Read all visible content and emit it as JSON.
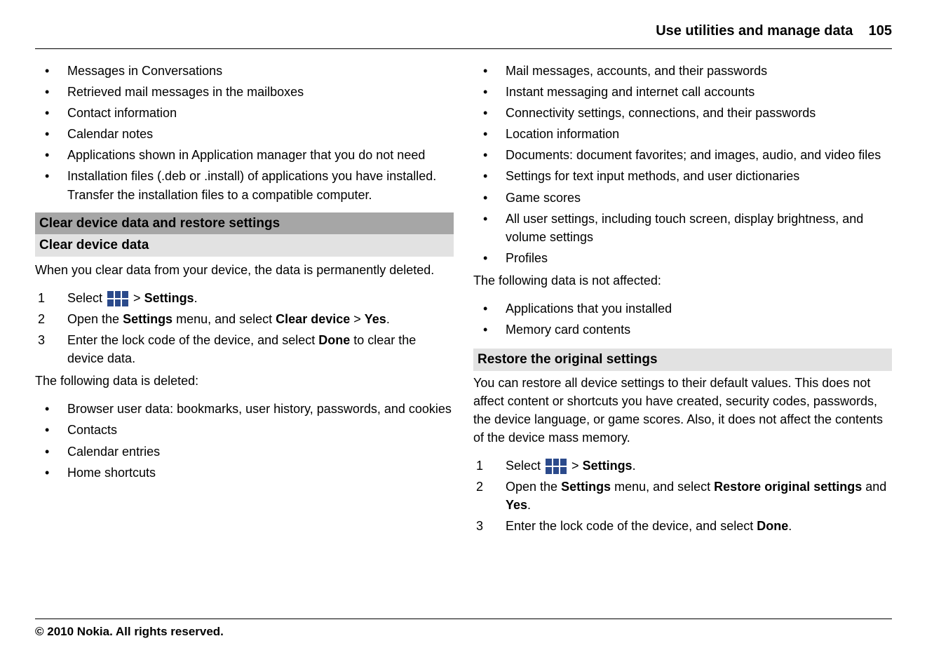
{
  "header": {
    "section_title": "Use utilities and manage data",
    "page_number": "105"
  },
  "left": {
    "top_bullets": [
      "Messages in Conversations",
      "Retrieved mail messages in the mailboxes",
      "Contact information",
      "Calendar notes",
      "Applications shown in Application manager that you do not need",
      "Installation files (.deb or .install) of applications you have installed. Transfer the installation files to a compatible computer."
    ],
    "heading_dark": "Clear device data and restore settings",
    "heading_light": "Clear device data",
    "intro": "When you clear data from your device, the data is permanently deleted.",
    "step1_prefix": "Select ",
    "step1_sep": " > ",
    "step1_bold": "Settings",
    "step1_period": ".",
    "step2_prefix": "Open the ",
    "step2_b1": "Settings",
    "step2_mid": " menu, and select ",
    "step2_b2": "Clear device",
    "step2_sep": " > ",
    "step2_b3": "Yes",
    "step2_period": ".",
    "step3_prefix": "Enter the lock code of the device, and select ",
    "step3_b1": "Done",
    "step3_suffix": " to clear the device data.",
    "deleted_intro": "The following data is deleted:",
    "deleted_bullets": [
      "Browser user data: bookmarks, user history, passwords, and cookies",
      "Contacts",
      "Calendar entries",
      "Home shortcuts"
    ]
  },
  "right": {
    "top_bullets": [
      "Mail messages, accounts, and their passwords",
      "Instant messaging and internet call accounts",
      "Connectivity settings, connections, and their passwords",
      "Location information",
      "Documents: document favorites; and images, audio, and video files",
      "Settings for text input methods, and user dictionaries",
      "Game scores",
      "All user settings, including touch screen, display brightness, and volume settings",
      "Profiles"
    ],
    "not_affected_intro": "The following data is not affected:",
    "not_affected_bullets": [
      "Applications that you installed",
      "Memory card contents"
    ],
    "heading_light": "Restore the original settings",
    "restore_intro": "You can restore all device settings to their default values. This does not affect content or shortcuts you have created, security codes, passwords, the device language, or game scores. Also, it does not affect the contents of the device mass memory.",
    "step1_prefix": "Select ",
    "step1_sep": " > ",
    "step1_bold": "Settings",
    "step1_period": ".",
    "step2_prefix": "Open the ",
    "step2_b1": "Settings",
    "step2_mid": " menu, and select ",
    "step2_b2": "Restore original settings",
    "step2_and": " and ",
    "step2_b3": "Yes",
    "step2_period": ".",
    "step3_prefix": "Enter the lock code of the device, and select ",
    "step3_b1": "Done",
    "step3_period": "."
  },
  "footer": "© 2010 Nokia. All rights reserved."
}
